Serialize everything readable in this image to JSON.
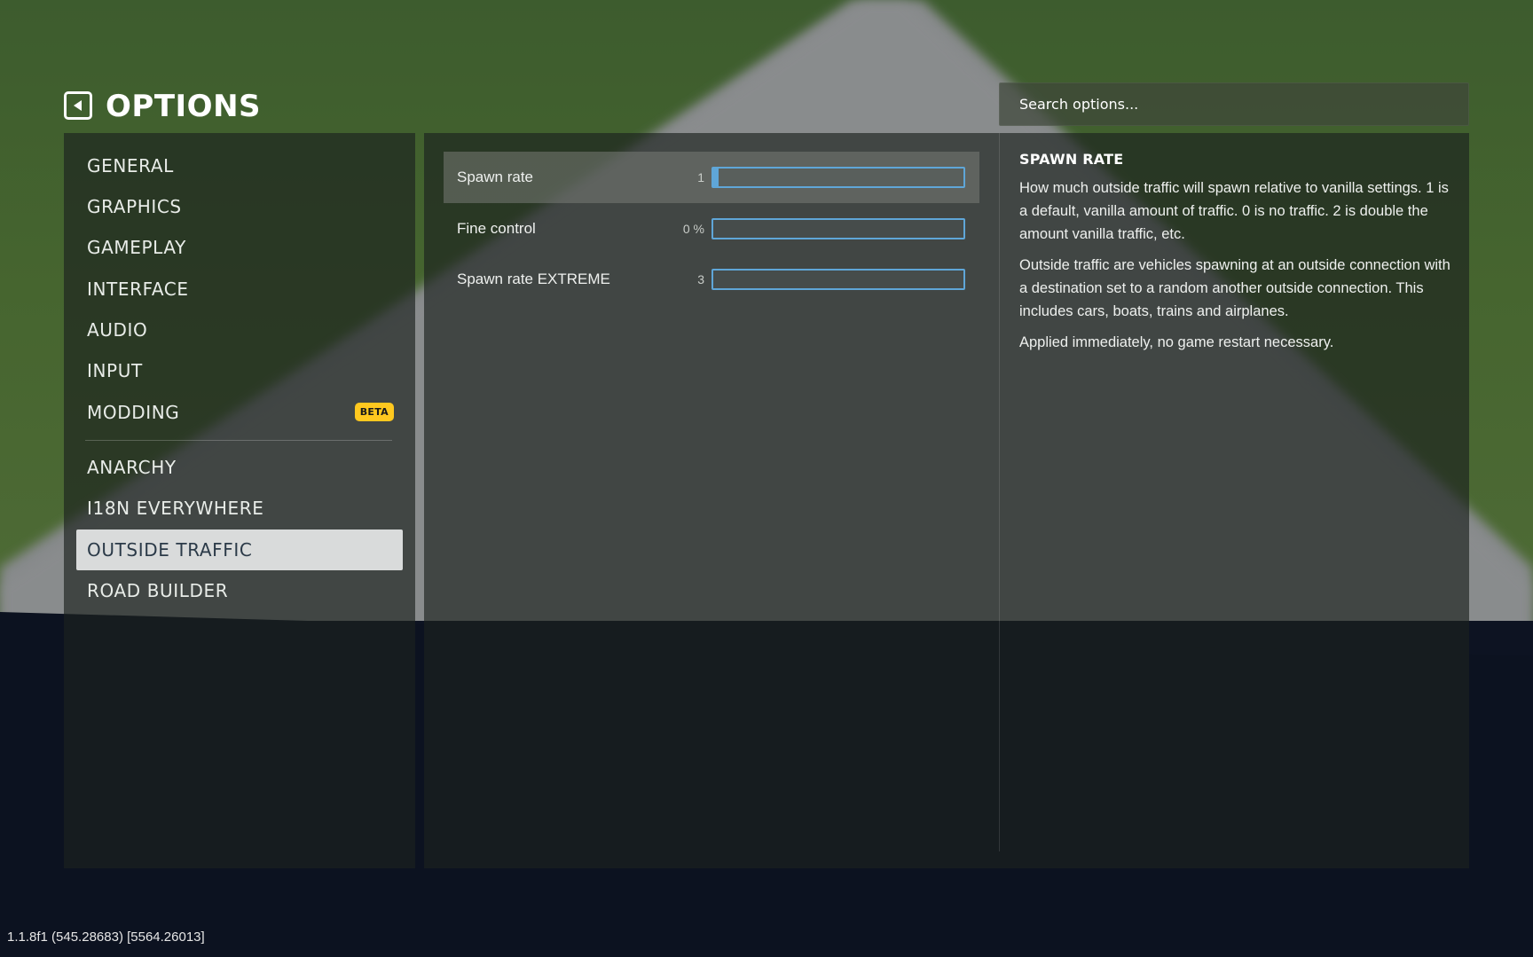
{
  "header": {
    "title": "OPTIONS",
    "back_icon": "back-arrow-icon"
  },
  "search": {
    "placeholder": "Search options..."
  },
  "sidebar": {
    "items": [
      {
        "label": "GENERAL"
      },
      {
        "label": "GRAPHICS"
      },
      {
        "label": "GAMEPLAY"
      },
      {
        "label": "INTERFACE"
      },
      {
        "label": "AUDIO"
      },
      {
        "label": "INPUT"
      },
      {
        "label": "MODDING",
        "badge": "BETA"
      },
      {
        "label": "ANARCHY"
      },
      {
        "label": "I18N EVERYWHERE"
      },
      {
        "label": "OUTSIDE TRAFFIC",
        "active": true
      },
      {
        "label": "ROAD BUILDER"
      }
    ]
  },
  "settings": [
    {
      "label": "Spawn rate",
      "value": "1",
      "fill": 0.02
    },
    {
      "label": "Fine control",
      "value": "0 %",
      "fill": 0
    },
    {
      "label": "Spawn rate EXTREME",
      "value": "3",
      "fill": 0
    }
  ],
  "description": {
    "title": "SPAWN RATE",
    "paragraphs": [
      "How much outside traffic will spawn relative to vanilla settings. 1 is a default, vanilla amount of traffic. 0 is no traffic. 2 is double the amount vanilla traffic, etc.",
      "Outside traffic are vehicles spawning at an outside connection with a destination set to a random another outside connection. This includes cars, boats, trains and airplanes.",
      "Applied immediately, no game restart necessary."
    ]
  },
  "footer": {
    "version": "1.1.8f1 (545.28683) [5564.26013]"
  },
  "colors": {
    "accent": "#5fa6d8",
    "badge": "#ffc81f",
    "active_item_bg": "#eef0f0",
    "active_item_text": "#2b3a48"
  }
}
